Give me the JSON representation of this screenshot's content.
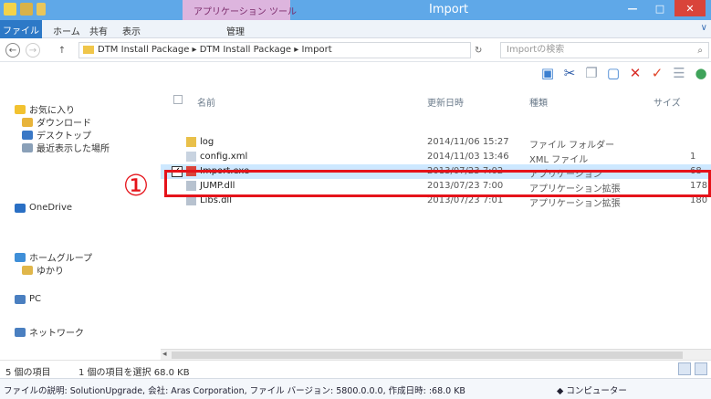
{
  "window": {
    "title": "Import",
    "context_tab_title": "アプリケーション ツール",
    "close_glyph": "✕",
    "minimize_glyph": "—",
    "maximize_glyph": "□"
  },
  "ribbon": {
    "file_tab": "ファイル",
    "tabs": [
      "ホーム",
      "共有",
      "表示",
      "管理"
    ],
    "expand_glyph": "∨"
  },
  "address": {
    "back_glyph": "←",
    "forward_glyph": "→",
    "up_glyph": "↑",
    "path": "DTM Install Package ▸ DTM Install Package ▸ Import",
    "refresh_glyph": "↻",
    "search_placeholder": "Importの検索",
    "search_glyph": "⌕"
  },
  "toolbar": {
    "icons": [
      {
        "name": "layout-icon",
        "glyph": "▣",
        "color": "#3b7fd0"
      },
      {
        "name": "cut-icon",
        "glyph": "✂",
        "color": "#2a5aa8"
      },
      {
        "name": "copy-icon",
        "glyph": "❐",
        "color": "#9aa6b4"
      },
      {
        "name": "paste-icon",
        "glyph": "▢",
        "color": "#3b7fd0"
      },
      {
        "name": "delete-icon",
        "glyph": "✕",
        "color": "#d9302a"
      },
      {
        "name": "check-icon",
        "glyph": "✓",
        "color": "#e0462a"
      },
      {
        "name": "rename-icon",
        "glyph": "☰",
        "color": "#9aa6b4"
      },
      {
        "name": "globe-icon",
        "glyph": "●",
        "color": "#3fa35a"
      }
    ]
  },
  "nav": {
    "favorites": "お気に入り",
    "downloads": "ダウンロード",
    "desktop": "デスクトップ",
    "recent": "最近表示した場所",
    "onedrive": "OneDrive",
    "homegroup": "ホームグループ",
    "homegroup_child": "ゆかり",
    "pc": "PC",
    "network": "ネットワーク"
  },
  "columns": {
    "name": "名前",
    "date": "更新日時",
    "type": "種類",
    "size": "サイズ"
  },
  "files": [
    {
      "name": "log",
      "date": "2014/11/06 15:27",
      "type": "ファイル フォルダー",
      "size": "",
      "icon": "folder-icon"
    },
    {
      "name": "config.xml",
      "date": "2014/11/03 13:46",
      "type": "XML ファイル",
      "size": "1",
      "icon": "xml-file-icon"
    },
    {
      "name": "Import.exe",
      "date": "2013/07/23 7:02",
      "type": "アプリケーション",
      "size": "68",
      "icon": "app-file-icon",
      "selected": true
    },
    {
      "name": "JUMP.dll",
      "date": "2013/07/23 7:00",
      "type": "アプリケーション拡張",
      "size": "178",
      "icon": "dll-file-icon"
    },
    {
      "name": "Libs.dll",
      "date": "2013/07/23 7:01",
      "type": "アプリケーション拡張",
      "size": "180",
      "icon": "dll-file-icon"
    }
  ],
  "callout": "①",
  "status": {
    "count": "5 個の項目",
    "selection": "1 個の項目を選択  68.0 KB"
  },
  "details": {
    "text": "ファイルの説明: SolutionUpgrade, 会社: Aras Corporation, ファイル バージョン: 5800.0.0.0, 作成日時: :68.0 KB",
    "location": "コンピューター"
  },
  "colors": {
    "titlebar": "#5fa8e8",
    "highlight": "#e5131a",
    "selection": "#cde8ff"
  }
}
